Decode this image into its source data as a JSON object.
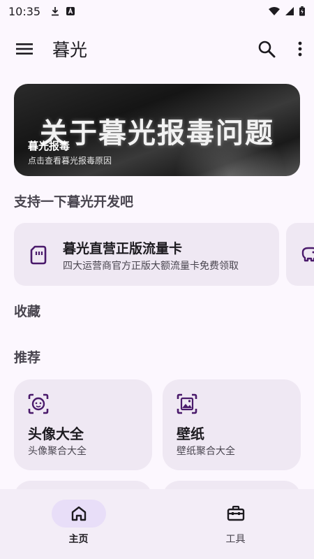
{
  "status_bar": {
    "time": "10:35"
  },
  "app_bar": {
    "title": "暮光"
  },
  "banner": {
    "headline": "关于暮光报毒问题",
    "title": "暮光报毒",
    "subtitle": "点击查看暮光报毒原因"
  },
  "sections": {
    "support": "支持一下暮光开发吧",
    "favorites": "收藏",
    "recommend": "推荐"
  },
  "support_cards": [
    {
      "title": "暮光直营正版流量卡",
      "description": "四大运营商官方正版大额流量卡免费领取",
      "icon": "sim-card-icon"
    },
    {
      "title": "",
      "description": "",
      "icon": "piggy-bank-icon"
    }
  ],
  "recommend_cards": [
    {
      "title": "头像大全",
      "description": "头像聚合大全",
      "icon": "face-scan-icon"
    },
    {
      "title": "壁纸",
      "description": "壁纸聚合大全",
      "icon": "image-frame-icon"
    }
  ],
  "bottom_nav": [
    {
      "label": "主页",
      "icon": "home-icon",
      "active": true
    },
    {
      "label": "工具",
      "icon": "toolbox-icon",
      "active": false
    }
  ],
  "colors": {
    "background": "#fcf7fe",
    "card": "#efe8f3",
    "accent": "#4a1a6b",
    "nav_indicator": "#e8def8"
  }
}
